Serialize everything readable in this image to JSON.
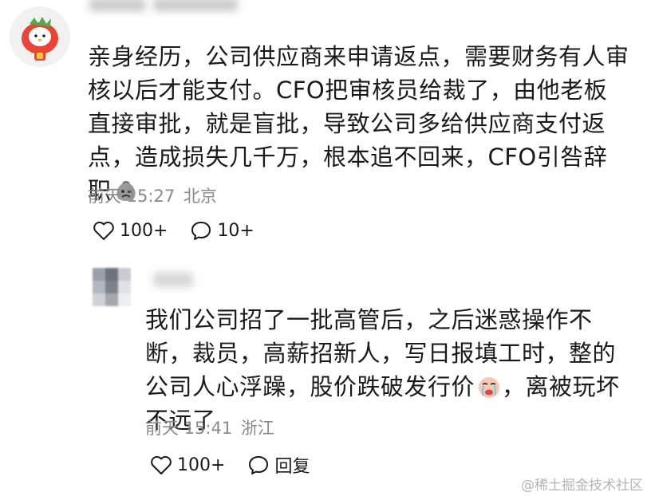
{
  "comment": {
    "text": "亲身经历，公司供应商来申请返点，需要财务有人审核以后才能支付。CFO把审核员给裁了，由他老板直接审批，就是盲批，导致公司多给供应商支付返点，造成损失几千万，根本追不回来，CFO引咎辞职",
    "emoji": "sad-sack-emoji",
    "time": "前天 15:27",
    "location": "北京",
    "like_count": "100+",
    "reply_count": "10+"
  },
  "reply": {
    "text": "我们公司招了一批高管后，之后迷惑操作不断，裁员，高薪招新人，写日报填工时，整的公司人心浮躁，股价跌破发行价",
    "emoji": "crying-face-emoji",
    "text_tail": "，离被玩坏不远了",
    "time": "前天 15:41",
    "location": "浙江",
    "like_count": "100+",
    "reply_label": "回复"
  },
  "watermark": "@稀土掘金技术社区"
}
